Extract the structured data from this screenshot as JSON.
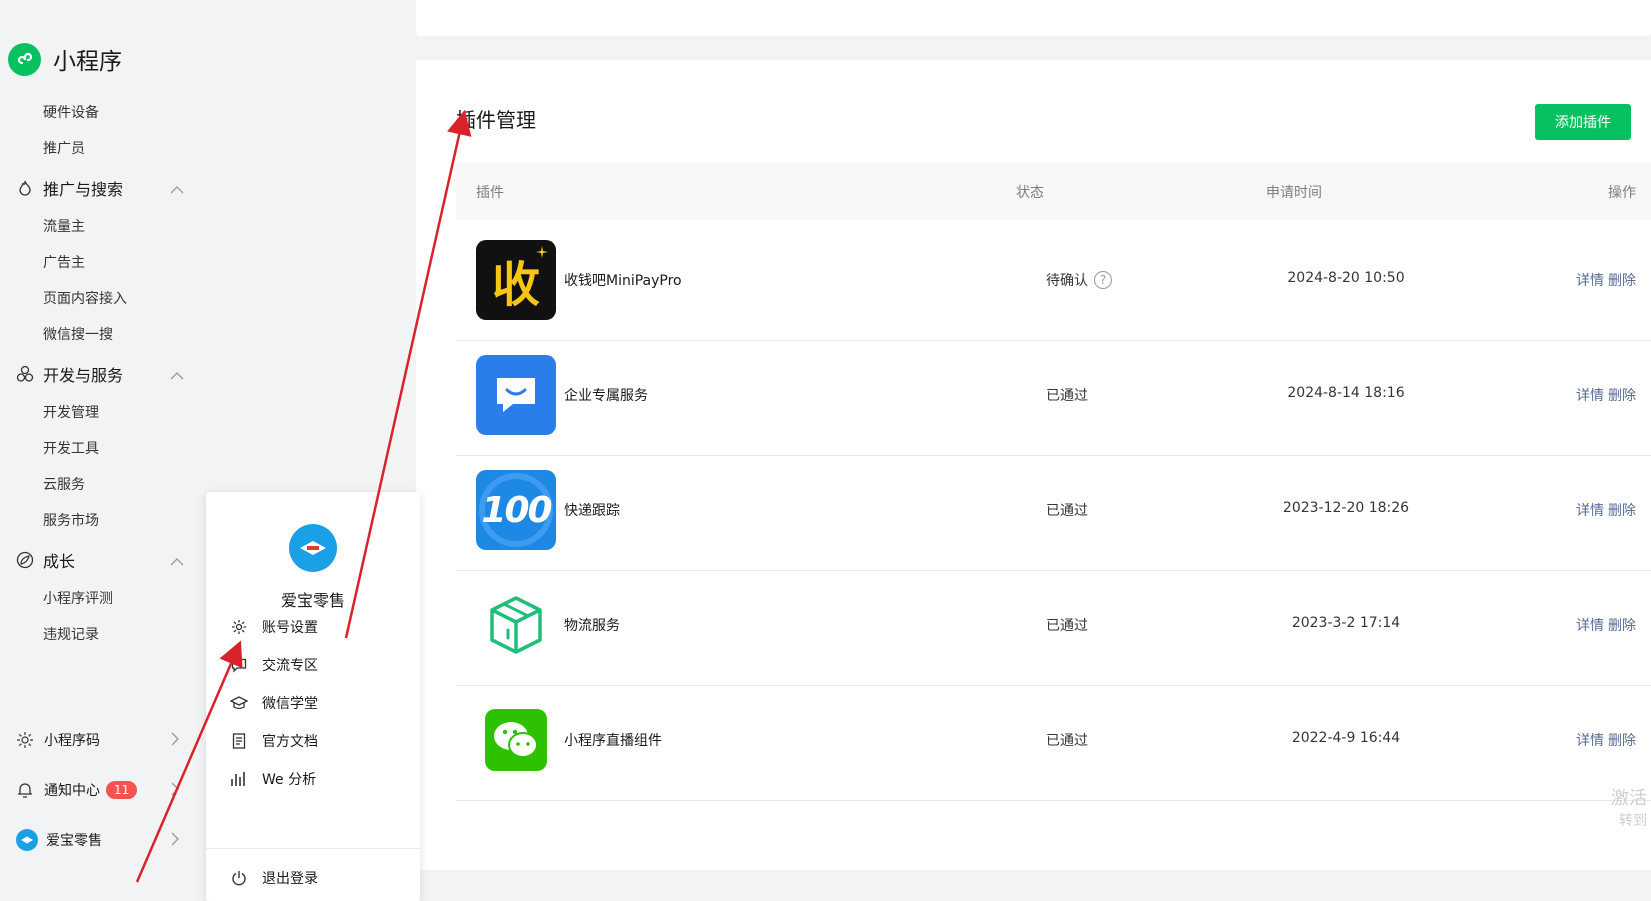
{
  "sidebar": {
    "brand": "小程序",
    "items_top": [
      "硬件设备",
      "推广员"
    ],
    "group_promo": "推广与搜索",
    "items_promo": [
      "流量主",
      "广告主",
      "页面内容接入",
      "微信搜一搜"
    ],
    "group_dev": "开发与服务",
    "items_dev": [
      "开发管理",
      "开发工具",
      "云服务",
      "服务市场"
    ],
    "group_growth": "成长",
    "items_growth": [
      "小程序评测",
      "违规记录"
    ],
    "footer": {
      "qrcode": "小程序码",
      "notice": "通知中心",
      "notice_count": "11",
      "account": "爱宝零售"
    }
  },
  "popup": {
    "name": "爱宝零售",
    "items": [
      "账号设置",
      "交流专区",
      "微信学堂",
      "官方文档",
      "We 分析"
    ],
    "logout": "退出登录"
  },
  "main": {
    "title": "插件管理",
    "add_button": "添加插件",
    "headers": [
      "插件",
      "状态",
      "申请时间",
      "操作"
    ],
    "rows": [
      {
        "name": "收钱吧MiniPayPro",
        "status": "待确认",
        "time": "2024-8-20 10:50",
        "detail": "详情",
        "delete": "删除",
        "icon": "shouqianba-icon"
      },
      {
        "name": "企业专属服务",
        "status": "已通过",
        "time": "2024-8-14 18:16",
        "detail": "详情",
        "delete": "删除",
        "icon": "chat-bubble-icon"
      },
      {
        "name": "快递跟踪",
        "status": "已通过",
        "time": "2023-12-20 18:26",
        "detail": "详情",
        "delete": "删除",
        "icon": "kuaidi100-icon"
      },
      {
        "name": "物流服务",
        "status": "已通过",
        "time": "2023-3-2 17:14",
        "detail": "详情",
        "delete": "删除",
        "icon": "package-box-icon"
      },
      {
        "name": "小程序直播组件",
        "status": "已通过",
        "time": "2022-4-9 16:44",
        "detail": "详情",
        "delete": "删除",
        "icon": "wechat-icon"
      }
    ],
    "pending_help": "?",
    "icon1_text": "收",
    "icon3_text": "100"
  },
  "watermark": {
    "line1": "激活",
    "line2": "转到"
  },
  "colors": {
    "accent": "#07c160",
    "link": "#576b95",
    "badge": "#fa5151",
    "arrow": "#d8232a"
  }
}
